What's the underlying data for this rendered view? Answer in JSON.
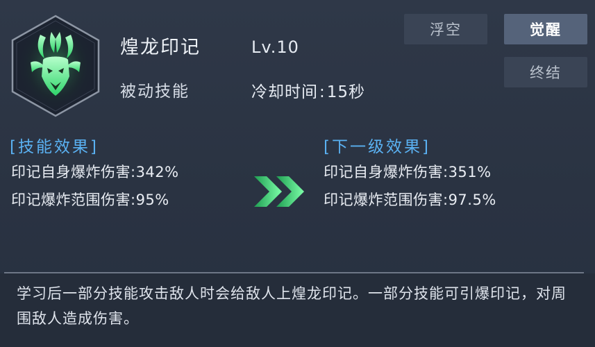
{
  "skill": {
    "name": "煌龙印记",
    "level": "Lv.10",
    "type": "被动技能",
    "cooldown_label": "冷却时间",
    "cooldown_value": "15秒",
    "icon": "dragon-mask-icon"
  },
  "tabs": {
    "float": "浮空",
    "awaken": "觉醒",
    "finish": "终结",
    "active": "awaken"
  },
  "current_effect": {
    "title": "[技能效果]",
    "line1": "印记自身爆炸伤害:342%",
    "line2": "印记爆炸范围伤害:95%"
  },
  "next_effect": {
    "title": "[下一级效果]",
    "line1": "印记自身爆炸伤害:351%",
    "line2": "印记爆炸范围伤害:97.5%"
  },
  "description": "学习后一部分技能攻击敌人时会给敌人上煌龙印记。一部分技能可引爆印记，对周围敌人造成伤害。",
  "colors": {
    "accent_blue": "#5ab1f2",
    "icon_green": "#5ef08a",
    "active_tab": "#55637a"
  }
}
